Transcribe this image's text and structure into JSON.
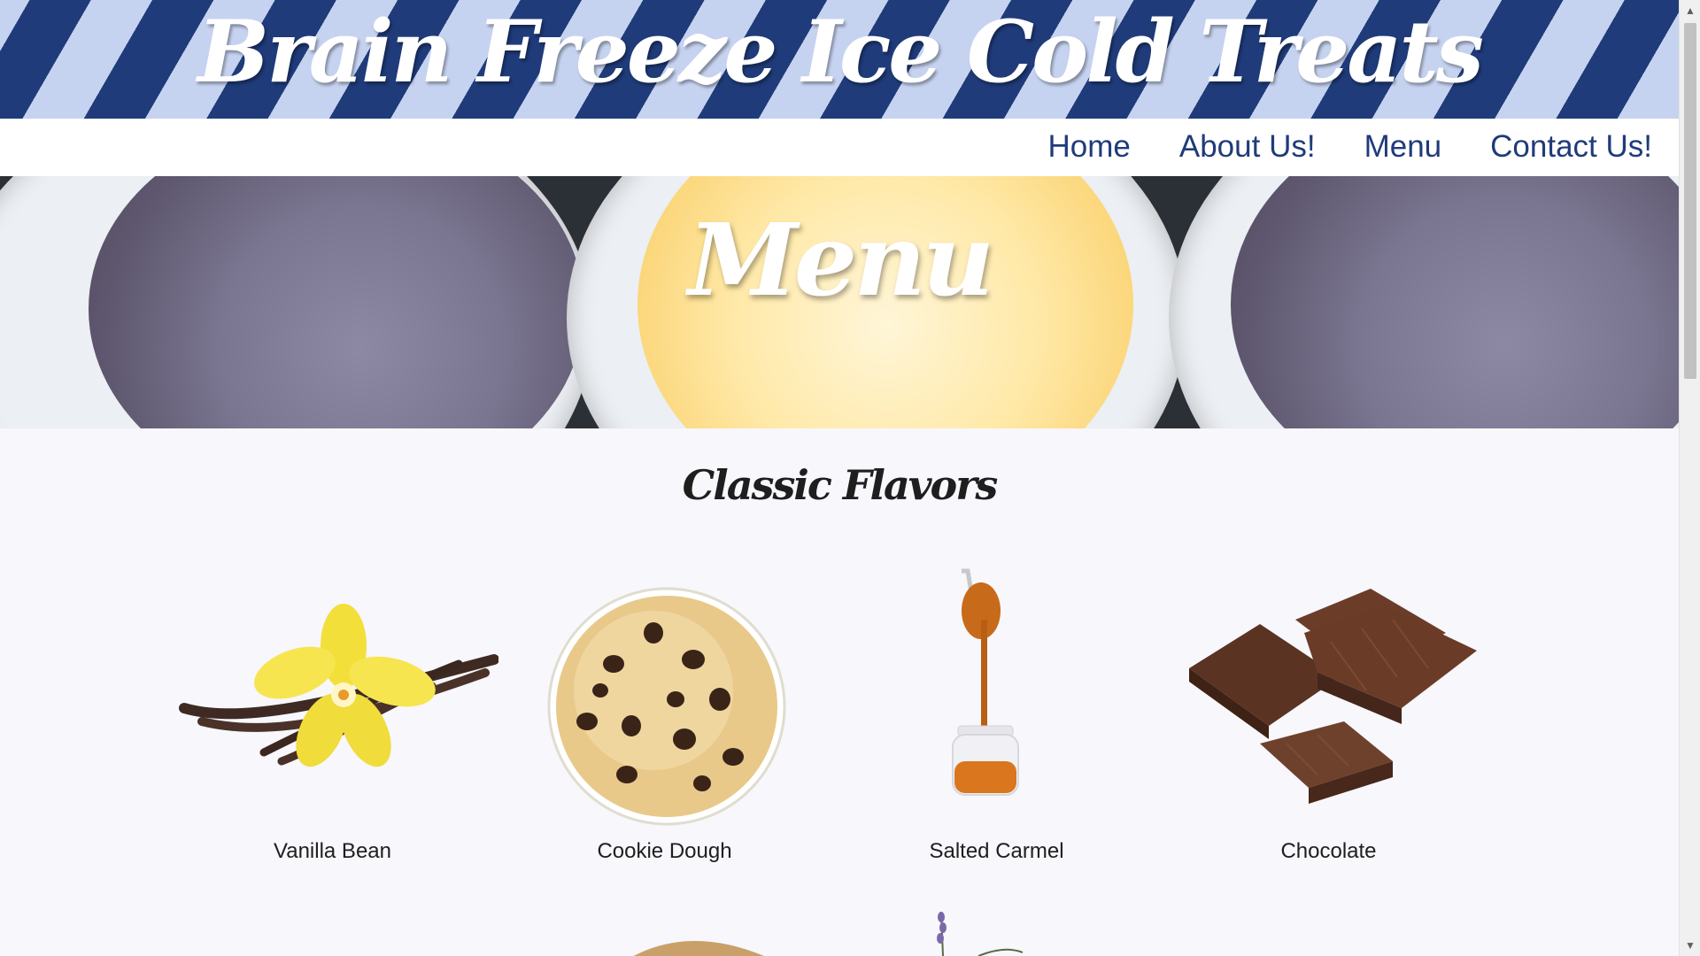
{
  "site": {
    "title": "Brain Freeze Ice Cold Treats"
  },
  "nav": {
    "items": [
      "Home",
      "About Us!",
      "Menu",
      "Contact Us!"
    ]
  },
  "hero": {
    "title": "Menu"
  },
  "section": {
    "title": "Classic Flavors",
    "flavors": [
      "Vanilla Bean",
      "Cookie Dough",
      "Salted Carmel",
      "Chocolate"
    ]
  },
  "colors": {
    "navy": "#1f3b7a",
    "light_blue": "#c6d3f0",
    "page_bg": "#f7f7fc"
  },
  "scrollbar": {
    "up_icon": "triangle-up-icon",
    "down_icon": "triangle-down-icon"
  }
}
